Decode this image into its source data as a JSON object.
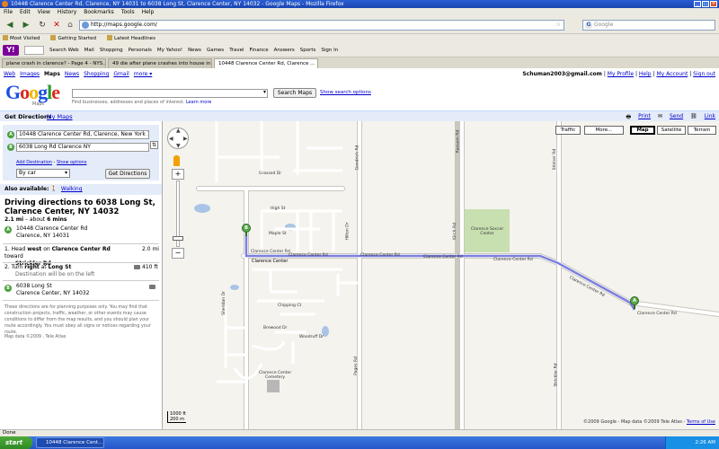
{
  "window": {
    "title": "10448 Clarence Center Rd, Clarence, NY 14031 to 6038 Long St, Clarence Center, NY 14032 - Google Maps - Mozilla Firefox",
    "menu": [
      "File",
      "Edit",
      "View",
      "History",
      "Bookmarks",
      "Tools",
      "Help"
    ],
    "url": "http://maps.google.com/",
    "search_placeholder": "Google"
  },
  "bookmarks": [
    "Most Visited",
    "Getting Started",
    "Latest Headlines"
  ],
  "yahoo_toolbar": [
    "Search Web",
    "Mail",
    "Shopping",
    "Personals",
    "My Yahoo!",
    "News",
    "Games",
    "Travel",
    "Finance",
    "Answers",
    "Sports",
    "Sign In"
  ],
  "tabs": [
    {
      "label": "plane crash in clarence? - Page 4 - NYS..."
    },
    {
      "label": "49 die after plane crashes into house in..."
    },
    {
      "label": "10448 Clarence Center Rd, Clarence ..."
    }
  ],
  "google": {
    "links": [
      "Web",
      "Images",
      "Maps",
      "News",
      "Shopping",
      "Gmail",
      "more ▾"
    ],
    "current": "Maps",
    "user_email": "Schuman2003@gmail.com",
    "user_links": [
      "My Profile",
      "Help",
      "My Account",
      "Sign out"
    ],
    "logo_sub": "Maps",
    "search_button": "Search Maps",
    "show_options": "Show search options",
    "hint": "Find businesses, addresses and places of interest.",
    "hint_link": "Learn more"
  },
  "panel_bar": {
    "get_directions": "Get Directions",
    "my_maps": "My Maps",
    "print": "Print",
    "send": "Send",
    "link": "Link"
  },
  "directions": {
    "from": "10448 Clarence Center Rd, Clarence, New York 14",
    "to": "6038 Long Rd Clarence NY",
    "add_destination": "Add Destination",
    "show_options": "Show options",
    "mode": "By car",
    "button": "Get Directions",
    "also_label": "Also available:",
    "also_link": "Walking",
    "title": "Driving directions to 6038 Long St, Clarence Center, NY 14032",
    "distance": "2.1 mi",
    "time_prefix": " – about ",
    "time": "6 mins",
    "start_line1": "10448 Clarence Center Rd",
    "start_line2": "Clarence, NY 14031",
    "step1_pre": "1.  Head ",
    "step1_dir": "west",
    "step1_mid": " on ",
    "step1_road": "Clarence Center Rd",
    "step1_post": " toward",
    "step1_road2": "Strickler Rd",
    "step1_dist": "2.0 mi",
    "step2_pre": "2.  Turn ",
    "step2_dir": "right",
    "step2_mid": " at ",
    "step2_road": "Long St",
    "step2_note": "Destination will be on the left",
    "step2_dist": "410 ft",
    "end_line1": "6038 Long St",
    "end_line2": "Clarence Center, NY 14032",
    "disclaimer": "These directions are for planning purposes only. You may find that construction projects, traffic, weather, or other events may cause conditions to differ from the map results, and you should plan your route accordingly. You must obey all signs or notices regarding your route.",
    "map_data": "Map data ©2009 , Tele Atlas"
  },
  "map": {
    "buttons": [
      "Traffic",
      "More...",
      "Map",
      "Satellite",
      "Terrain"
    ],
    "selected": "Map",
    "marker_a": "A",
    "marker_b": "B",
    "scale_top": "1000 ft",
    "scale_bottom": "200 m",
    "copyright": "©2009 Google - Map data ©2009 Tele Atlas - ",
    "terms": "Terms of Use",
    "labels": {
      "clarence_center": "Clarence Center",
      "ccr1": "Clarence Center Rd",
      "ccr2": "Clarence Center Rd",
      "ccr3": "Clarence Center Rd",
      "ccr4": "Clarence Center Rd",
      "ccr5": "Clarence Center Rd",
      "ccr6": "Clarence Center Rd",
      "ccr7": "Clarence Center Rd",
      "park": "Clarence Soccer Center",
      "cemetery": "Clarence Center Cemetery",
      "high": "High St",
      "maple": "Maple St",
      "hilton": "Hilton Dr",
      "goodrich": "Goodrich Rd",
      "strickler": "Strickler Rd",
      "chipping": "Chipping Ct",
      "woodruff": "Woodruff Dr",
      "grassed": "Grassed Dr",
      "bresnoll": "Brewood Dr",
      "sheridan": "Sheridan Dr",
      "pages": "Pages Rd",
      "kirch": "Kirch Rd",
      "ransom": "Ransom Rd",
      "shimer": "Shimer Rd"
    }
  },
  "status": "Done",
  "taskbar": {
    "start": "start",
    "task": "10448 Clarence Cent...",
    "clock": "2:26 AM"
  }
}
